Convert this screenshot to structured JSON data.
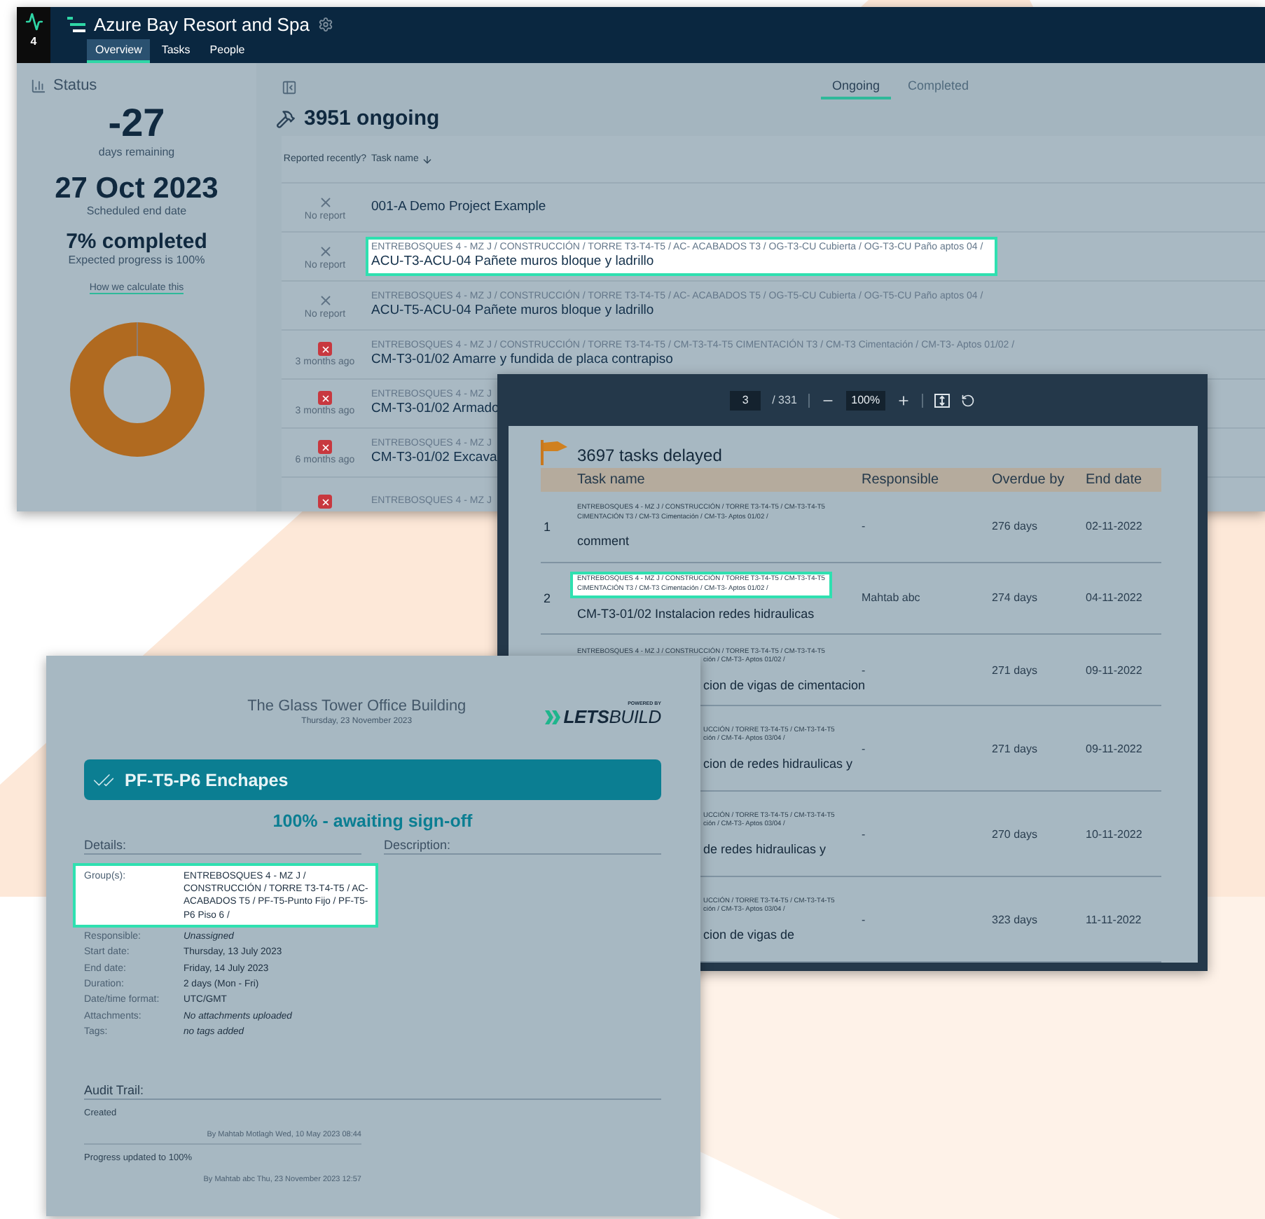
{
  "project_window": {
    "badge": "4",
    "title": "Azure Bay Resort and Spa",
    "tabs": [
      {
        "label": "Overview",
        "selected": true
      },
      {
        "label": "Tasks",
        "selected": false
      },
      {
        "label": "People",
        "selected": false
      }
    ],
    "status": {
      "heading": "Status",
      "days": "-27",
      "days_label": "days remaining",
      "end_date": "27 Oct 2023",
      "end_date_label": "Scheduled end date",
      "completed": "7% completed",
      "expected": "Expected progress is 100%",
      "link": "How we calculate this"
    },
    "view_tabs": [
      {
        "label": "Ongoing",
        "selected": true
      },
      {
        "label": "Completed",
        "selected": false
      }
    ],
    "heading": "3951 ongoing",
    "columns": [
      "Reported recently?",
      "Task name"
    ],
    "rows": [
      {
        "kind": "none",
        "report_label": "No report",
        "name": "001-A Demo Project Example",
        "highlighted": false
      },
      {
        "kind": "none",
        "report_label": "No report",
        "path": "ENTREBOSQUES 4 - MZ J / CONSTRUCCIÓN / TORRE T3-T4-T5 / AC- ACABADOS T3 / OG-T3-CU Cubierta / OG-T3-CU Paño aptos 04 /",
        "name": "ACU-T3-ACU-04 Pañete muros bloque y ladrillo",
        "highlighted": true
      },
      {
        "kind": "none",
        "report_label": "No report",
        "path": "ENTREBOSQUES 4 - MZ J / CONSTRUCCIÓN / TORRE T3-T4-T5 / AC- ACABADOS T5 / OG-T5-CU Cubierta / OG-T5-CU Paño aptos 04 /",
        "name": "ACU-T5-ACU-04 Pañete muros bloque y ladrillo",
        "highlighted": false
      },
      {
        "kind": "late",
        "report_label": "3 months ago",
        "path": "ENTREBOSQUES 4 - MZ J / CONSTRUCCIÓN / TORRE T3-T4-T5 / CM-T3-T4-T5 CIMENTACIÓN T3 / CM-T3 Cimentación / CM-T3- Aptos 01/02 /",
        "name": "CM-T3-01/02 Amarre y fundida de placa contrapiso",
        "highlighted": false
      },
      {
        "kind": "late",
        "report_label": "3 months ago",
        "path": "ENTREBOSQUES 4 - MZ J",
        "name": "CM-T3-01/02 Armado",
        "highlighted": false
      },
      {
        "kind": "late",
        "report_label": "6 months ago",
        "path": "ENTREBOSQUES 4 - MZ J",
        "name": "CM-T3-01/02 Excava",
        "highlighted": false
      },
      {
        "kind": "late",
        "path": "ENTREBOSQUES 4 - MZ J",
        "highlighted": false
      }
    ]
  },
  "pdf_viewer": {
    "page": "3",
    "pages": "/ 331",
    "zoom": "100%",
    "title": "3697 tasks delayed",
    "columns": [
      "Task name",
      "Responsible",
      "Overdue by",
      "End date"
    ],
    "rows": [
      {
        "kind": "full",
        "number": "1",
        "path_lines": [
          {
            "kind": "full",
            "text": "ENTREBOSQUES 4 - MZ J / CONSTRUCCIÓN / TORRE T3-T4-T5 / CM-T3-T4-T5"
          },
          {
            "kind": "full",
            "text": "CIMENTACIÓN T3 / CM-T3 Cimentación / CM-T3- Aptos 01/02 /"
          }
        ],
        "name": "comment",
        "responsible": "-",
        "overdue": "276 days",
        "end": "02-11-2022",
        "highlighted": false
      },
      {
        "kind": "full",
        "number": "2",
        "path_lines": [
          {
            "kind": "full",
            "text": "ENTREBOSQUES 4 - MZ J / CONSTRUCCIÓN / TORRE T3-T4-T5 / CM-T3-T4-T5"
          },
          {
            "kind": "full",
            "text": "CIMENTACIÓN T3 / CM-T3 Cimentación / CM-T3- Aptos 01/02 /"
          }
        ],
        "name": "CM-T3-01/02 Instalacion redes hidraulicas",
        "responsible": "Mahtab abc",
        "overdue": "274 days",
        "end": "04-11-2022",
        "highlighted": true
      },
      {
        "kind": "fragment",
        "path_lines": [
          {
            "kind": "full",
            "text": "ENTREBOSQUES 4 - MZ J / CONSTRUCCIÓN / TORRE T3-T4-T5 / CM-T3-T4-T5"
          },
          {
            "kind": "fragment",
            "text": "ción / CM-T3- Aptos 01/02 /"
          }
        ],
        "name": "cion de vigas de cimentacion",
        "responsible": "-",
        "overdue": "271 days",
        "end": "09-11-2022",
        "highlighted": false
      },
      {
        "kind": "fragment",
        "path_lines": [
          {
            "kind": "fragment",
            "text": "UCCIÓN / TORRE T3-T4-T5 / CM-T3-T4-T5"
          },
          {
            "kind": "fragment",
            "text": "ción / CM-T4- Aptos 03/04 /"
          }
        ],
        "name": "cion de redes hidraulicas y",
        "responsible": "-",
        "overdue": "271 days",
        "end": "09-11-2022",
        "highlighted": false
      },
      {
        "kind": "fragment",
        "path_lines": [
          {
            "kind": "fragment",
            "text": "UCCIÓN / TORRE T3-T4-T5 / CM-T3-T4-T5"
          },
          {
            "kind": "fragment",
            "text": "ción / CM-T3- Aptos 03/04 /"
          }
        ],
        "name": "de redes hidraulicas y",
        "responsible": "-",
        "overdue": "270 days",
        "end": "10-11-2022",
        "highlighted": false
      },
      {
        "kind": "fragment",
        "path_lines": [
          {
            "kind": "fragment",
            "text": "UCCIÓN / TORRE T3-T4-T5 / CM-T3-T4-T5"
          },
          {
            "kind": "fragment",
            "text": "ción / CM-T3- Aptos 03/04 /"
          }
        ],
        "name": "cion de vigas de",
        "responsible": "-",
        "overdue": "323 days",
        "end": "11-11-2022",
        "highlighted": false
      }
    ]
  },
  "report": {
    "title": "The Glass Tower Office Building",
    "date": "Thursday, 23 November 2023",
    "logo_tagline": "POWERED BY",
    "logo_bold": "LETS",
    "logo_light": "BUILD",
    "task": "PF-T5-P6 Enchapes",
    "progress": "100% - awaiting sign-off",
    "details_heading": "Details:",
    "description_heading": "Description:",
    "fields": [
      {
        "label": "Group(s):",
        "value": "ENTREBOSQUES 4 - MZ J / CONSTRUCCIÓN / TORRE T3-T4-T5 / AC- ACABADOS T5 / PF-T5-Punto Fijo / PF-T5-P6 Piso 6 /",
        "italic": false,
        "highlighted": true
      },
      {
        "label": "Responsible:",
        "value": "Unassigned",
        "italic": true,
        "highlighted": false
      },
      {
        "label": "Start date:",
        "value": "Thursday, 13 July 2023",
        "italic": false,
        "highlighted": false
      },
      {
        "label": "End date:",
        "value": "Friday, 14 July 2023",
        "italic": false,
        "highlighted": false
      },
      {
        "label": "Duration:",
        "value": "2 days (Mon - Fri)",
        "italic": false,
        "highlighted": false
      },
      {
        "label": "Date/time format:",
        "value": "UTC/GMT",
        "italic": false,
        "highlighted": false
      },
      {
        "label": "Attachments:",
        "value": "No attachments uploaded",
        "italic": true,
        "highlighted": false
      },
      {
        "label": "Tags:",
        "value": "no tags added",
        "italic": true,
        "highlighted": false
      }
    ],
    "audit_heading": "Audit Trail:",
    "audit": [
      {
        "action": "Created",
        "by": "By Mahtab Motlagh Wed, 10 May 2023 08:44"
      },
      {
        "action": "Progress updated to 100%",
        "by": "By Mahtab abc Thu, 23 November 2023 12:57"
      }
    ]
  }
}
